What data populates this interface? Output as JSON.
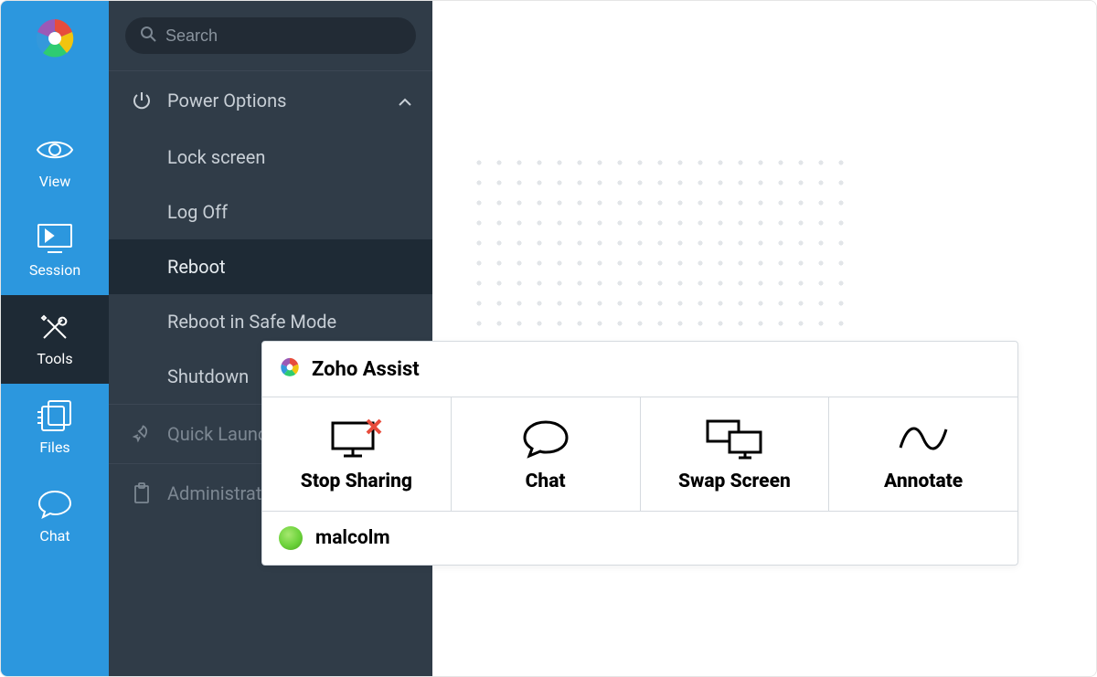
{
  "search": {
    "placeholder": "Search"
  },
  "sidebar_tabs": [
    {
      "label": "View"
    },
    {
      "label": "Session"
    },
    {
      "label": "Tools"
    },
    {
      "label": "Files"
    },
    {
      "label": "Chat"
    }
  ],
  "tools_panel": {
    "power_section": {
      "label": "Power Options",
      "items": [
        {
          "label": "Lock screen"
        },
        {
          "label": "Log Off"
        },
        {
          "label": "Reboot"
        },
        {
          "label": "Reboot in Safe Mode"
        },
        {
          "label": "Shutdown"
        }
      ]
    },
    "quick_launch": {
      "label": "Quick Launch"
    },
    "administrate": {
      "label": "Administrate"
    }
  },
  "toolbar": {
    "title": "Zoho Assist",
    "actions": [
      {
        "label": "Stop Sharing"
      },
      {
        "label": "Chat"
      },
      {
        "label": "Swap Screen"
      },
      {
        "label": "Annotate"
      }
    ],
    "user": {
      "name": "malcolm"
    }
  }
}
